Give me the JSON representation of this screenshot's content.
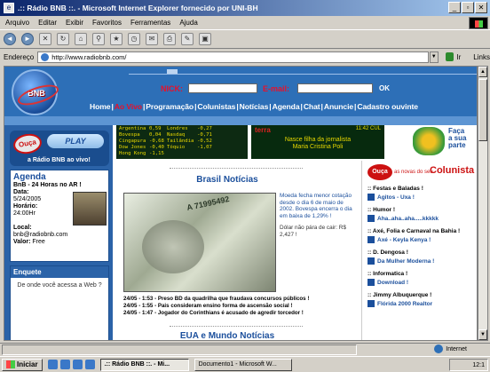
{
  "window": {
    "title": ".:: Rádio BNB ::. - Microsoft Internet Explorer fornecido por UNI-BH",
    "buttons": [
      "_",
      "▫",
      "✕"
    ]
  },
  "menu": [
    "Arquivo",
    "Editar",
    "Exibir",
    "Favoritos",
    "Ferramentas",
    "Ajuda"
  ],
  "address": {
    "label": "Endereço",
    "url": "http://www.radiobnb.com/",
    "go": "Ir",
    "links": "Links"
  },
  "header": {
    "logo_text": "BNB",
    "nick_label": "NICK:",
    "email_label": "E-mail:",
    "ok_label": "OK",
    "nav": [
      "Home",
      "Ao Vivo",
      "Programação",
      "Colunistas",
      "Notícias",
      "Agenda",
      "Chat",
      "Anuncie",
      "Cadastro ouvinte"
    ]
  },
  "left": {
    "ouca_label": "Ouça",
    "play_label": "PLAY",
    "ouca_sub": "a Rádio BNB ao vivo!",
    "agenda": {
      "title": "Agenda",
      "line1": "BnB - 24 Horas no AR !",
      "data_label": "Data:",
      "data_value": "5/24/2005",
      "horario_label": "Horário:",
      "horario_value": "24:00Hr",
      "local_label": "Local:",
      "local_value": "bnb@radiobnb.com",
      "valor_label": "Valor:",
      "valor_value": "Free"
    },
    "enquete": {
      "title": "Enquete",
      "question": "De onde você acessa a Web ?"
    }
  },
  "ticker": {
    "rows": [
      [
        "Argentina",
        "0,59",
        "Londres",
        "-0,27"
      ],
      [
        "Bovespa",
        "0,04",
        "Nasdaq",
        "-0,71"
      ],
      [
        "Cingapura",
        "-0,68",
        "Tailândia",
        "-0,52"
      ],
      [
        "Dow Jones",
        "-0,40",
        "Tóquio",
        "-1,07"
      ],
      [
        "Hong Kong",
        "-1,15",
        "",
        ""
      ]
    ]
  },
  "terra": {
    "brand": "terra",
    "time": "11:42 CUL",
    "news_line1": "Nasce filha da jornalista",
    "news_line2": "Maria Cristina Poli"
  },
  "faca": {
    "text1": "Faça",
    "text2": "a sua",
    "text3": "parte"
  },
  "center": {
    "section1": "Brasil Notícias",
    "money_serial": "A 71995492",
    "story_p1": "Moeda fecha menor cotação desde o dia 6 de maio de 2002. Bovespa encerra o dia em baixa de 1,29% !",
    "story_p2": "Dólar não pára de cair: R$ 2,427 !",
    "headlines": [
      "24/05 - 1:53 - Preso BD da quadrilha que fraudava concursos públicos !",
      "24/05 - 1:55 - Pais consideram ensino forma de ascensão social !",
      "24/05 - 1:47 - Jogador do Corinthians é acusado de agredir torcedor !"
    ],
    "section2": "EUA e Mundo Notícias"
  },
  "right": {
    "logo_text": "Ouça",
    "subtitle": "as novas do seu",
    "title": "Colunista",
    "items": [
      {
        "cat": ":: Festas e Baladas !",
        "link": "Agitos - Uxa !"
      },
      {
        "cat": ":: Humor !",
        "link": "Aha..aha..aha.....kkkkk"
      },
      {
        "cat": ":: Axé, Folia e Carnaval na Bahia !",
        "link": "Axé - Keyla Kenya !"
      },
      {
        "cat": ":: D. Dengosa !",
        "link": "Da Mulher Moderna !"
      },
      {
        "cat": ":: Informatica !",
        "link": "Download !"
      },
      {
        "cat": ":: Jimmy Albuquerque !",
        "link": "Flórida 2000 Realtor"
      }
    ]
  },
  "status": {
    "zone": "Internet"
  },
  "taskbar": {
    "start": "Iniciar",
    "tasks": [
      ".:: Rádio BNB ::. - Mi...",
      "Documento1 - Microsoft W..."
    ],
    "clock": "12:1"
  }
}
